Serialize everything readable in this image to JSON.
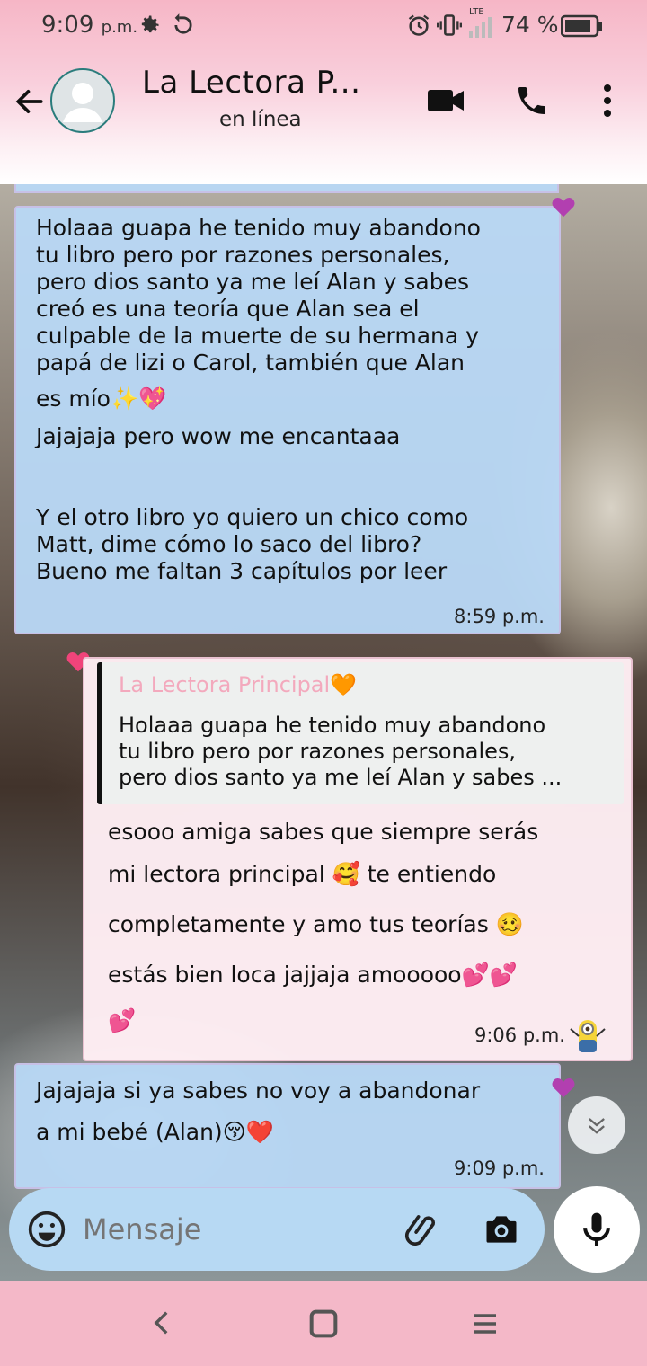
{
  "status": {
    "time": "9:09",
    "ampm": "p.m.",
    "network": "LTE",
    "battery": "74 %"
  },
  "header": {
    "contact_name": "La Lectora P...",
    "presence": "en línea"
  },
  "messages": [
    {
      "direction": "incoming",
      "text": "Holaaa guapa he tenido muy abandono tu libro pero por razones personales, pero dios santo ya me leí Alan y sabes creó es una teoría que Alan sea el culpable de la muerte de su hermana y papá de lizi o Carol, también que Alan es mío✨💖\nJajajaja pero wow me encantaaa\n\n\nY el otro libro yo quiero un chico como Matt, dime cómo lo saco del libro? Bueno me faltan 3 capítulos por leer",
      "lines": [
        "Holaaa guapa he tenido muy abandono",
        "tu libro pero por razones personales,",
        "pero dios santo ya me leí Alan y sabes",
        "creó es una teoría que Alan sea el",
        "culpable de la muerte de su hermana y",
        "papá de lizi o Carol, también que Alan",
        "es mío✨💖",
        "Jajajaja pero wow me encantaaa",
        "",
        "Y el otro libro yo quiero un chico como",
        "Matt, dime cómo lo saco del libro?",
        "Bueno me faltan 3 capítulos por leer"
      ],
      "time": "8:59 p.m."
    },
    {
      "direction": "outgoing",
      "quote_author": "La Lectora Principal🧡",
      "quote_lines": [
        "Holaaa guapa he tenido muy abandono",
        "tu libro pero por razones personales,",
        "pero dios santo ya me leí Alan y sabes ..."
      ],
      "lines": [
        "esooo amiga sabes que siempre serás",
        "mi lectora principal 🥰 te entiendo",
        "completamente y amo tus teorías 🥴",
        "estás bien loca jajjaja amooooo💕💕",
        "💕"
      ],
      "time": "9:06 p.m."
    },
    {
      "direction": "incoming",
      "lines": [
        "Jajajaja si ya sabes no voy a abandonar",
        "a mi bebé (Alan)😚❤️"
      ],
      "time": "9:09 p.m."
    }
  ],
  "composer": {
    "placeholder": "Mensaje"
  },
  "colors": {
    "incoming_bubble": "#b8d7f5",
    "outgoing_bubble": "#ffeef4",
    "theme_pink": "#f4b8c8",
    "quote_author": "#f3a9bd"
  }
}
